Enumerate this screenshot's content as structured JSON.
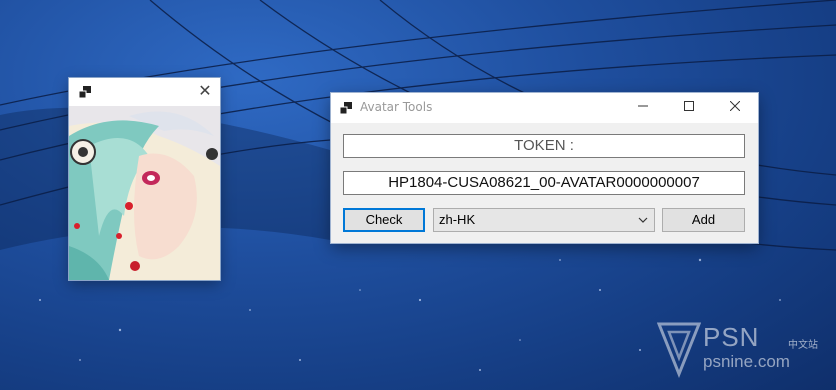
{
  "preview_window": {
    "close_glyph": "✕",
    "app_icon": "window-icon",
    "art": "anime-avatar-image"
  },
  "main_window": {
    "title": "Avatar Tools",
    "minimize_glyph": "—",
    "maximize_glyph": "☐",
    "close_glyph": "✕",
    "token_label": "TOKEN :",
    "avatar_id_value": "HP1804-CUSA08621_00-AVATAR0000000007",
    "check_label": "Check",
    "language_selected": "zh-HK",
    "add_label": "Add"
  },
  "watermark": {
    "brand": "PSN",
    "chinese_text": "中文站",
    "domain": "psnine.com"
  },
  "colors": {
    "desktop_blue": "#1f4f9f",
    "focus_blue": "#0078d7",
    "window_bg": "#f0f0f0"
  }
}
